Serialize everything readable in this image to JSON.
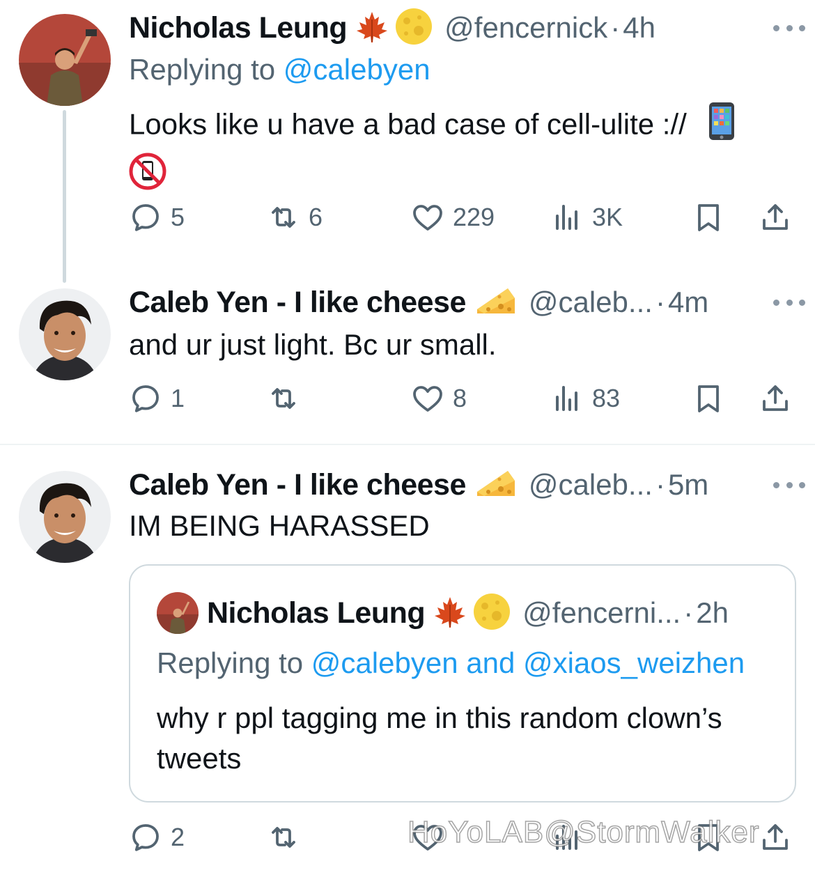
{
  "tweets": [
    {
      "name": "Nicholas Leung",
      "emojis": [
        "maple-leaf",
        "full-moon"
      ],
      "handle": "@fencernick",
      "dot": "·",
      "time": "4h",
      "replying_prefix": "Replying to ",
      "replying_to": "@calebyen",
      "text_line1": "Looks like u have a bad case of cell-ulite ://",
      "text_emojis": [
        "mobile-phone",
        "no-mobile-phones"
      ],
      "counts": {
        "replies": "5",
        "retweets": "6",
        "likes": "229",
        "views": "3K"
      }
    },
    {
      "name": "Caleb Yen - I like cheese",
      "emojis": [
        "cheese-wedge"
      ],
      "handle": "@caleb...",
      "dot": "·",
      "time": "4m",
      "text": "and ur just light. Bc ur small.",
      "counts": {
        "replies": "1",
        "retweets": "",
        "likes": "8",
        "views": "83"
      }
    },
    {
      "name": "Caleb Yen - I like cheese",
      "emojis": [
        "cheese-wedge"
      ],
      "handle": "@caleb...",
      "dot": "·",
      "time": "5m",
      "text": "IM BEING HARASSED",
      "quoted": {
        "name": "Nicholas Leung",
        "emojis": [
          "maple-leaf",
          "full-moon"
        ],
        "handle": "@fencerni...",
        "dot": "·",
        "time": "2h",
        "replying_prefix": "Replying to ",
        "replying_to": "@calebyen and @xiaos_weizhen",
        "text": "why r ppl tagging me in this random clown’s tweets"
      },
      "counts": {
        "replies": "2",
        "retweets": ""
      }
    }
  ],
  "watermark": "HoYoLAB@StormWalker",
  "colors": {
    "accent": "#1d9bf0",
    "secondary_text": "#536471",
    "text": "#0f1419"
  }
}
